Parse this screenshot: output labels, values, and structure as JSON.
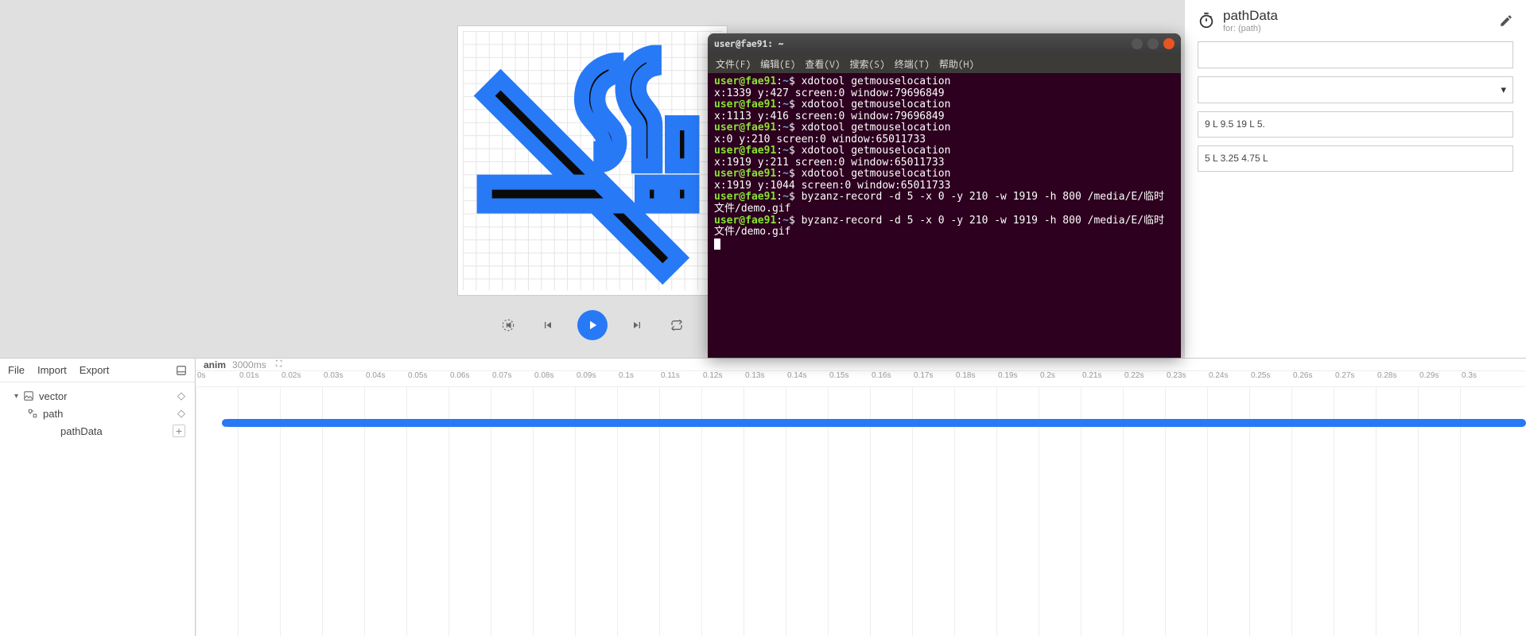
{
  "properties": {
    "title": "pathData",
    "subtitle": "for: (path)",
    "text1": "9 L 9.5 19 L 5.",
    "text2": "5 L 3.25 4.75 L"
  },
  "playback": {},
  "panel": {
    "file": "File",
    "import": "Import",
    "export": "Export"
  },
  "tree": {
    "vector": "vector",
    "path": "path",
    "pathData": "pathData"
  },
  "timeline": {
    "label": "anim",
    "duration": "3000ms",
    "ticks": [
      "0s",
      "0.01s",
      "0.02s",
      "0.03s",
      "0.04s",
      "0.05s",
      "0.06s",
      "0.07s",
      "0.08s",
      "0.09s",
      "0.1s",
      "0.11s",
      "0.12s",
      "0.13s",
      "0.14s",
      "0.15s",
      "0.16s",
      "0.17s",
      "0.18s",
      "0.19s",
      "0.2s",
      "0.21s",
      "0.22s",
      "0.23s",
      "0.24s",
      "0.25s",
      "0.26s",
      "0.27s",
      "0.28s",
      "0.29s",
      "0.3s"
    ]
  },
  "terminal": {
    "title": "user@fae91: ~",
    "menus": [
      "文件(F)",
      "编辑(E)",
      "查看(V)",
      "搜索(S)",
      "终端(T)",
      "帮助(H)"
    ],
    "promptUser": "user@fae91",
    "promptPath": "~",
    "lines": [
      {
        "t": "p",
        "cmd": "xdotool getmouselocation"
      },
      {
        "t": "o",
        "txt": "x:1339 y:427 screen:0 window:79696849"
      },
      {
        "t": "p",
        "cmd": "xdotool getmouselocation"
      },
      {
        "t": "o",
        "txt": "x:1113 y:416 screen:0 window:79696849"
      },
      {
        "t": "p",
        "cmd": "xdotool getmouselocation"
      },
      {
        "t": "o",
        "txt": "x:0 y:210 screen:0 window:65011733"
      },
      {
        "t": "p",
        "cmd": "xdotool getmouselocation"
      },
      {
        "t": "o",
        "txt": "x:1919 y:211 screen:0 window:65011733"
      },
      {
        "t": "p",
        "cmd": "xdotool getmouselocation"
      },
      {
        "t": "o",
        "txt": "x:1919 y:1044 screen:0 window:65011733"
      },
      {
        "t": "p",
        "cmd": "byzanz-record -d 5 -x 0 -y 210 -w 1919 -h 800 /media/E/临时文件/demo.gif"
      },
      {
        "t": "p",
        "cmd": "byzanz-record -d 5 -x 0 -y 210 -w 1919 -h 800 /media/E/临时文件/demo.gif"
      }
    ]
  }
}
